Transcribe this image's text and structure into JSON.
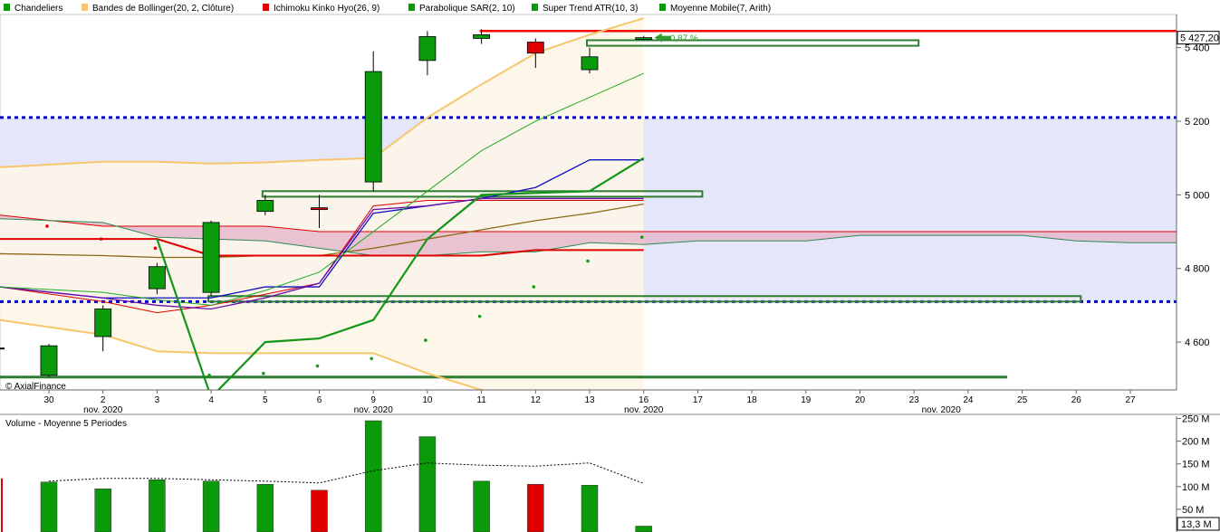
{
  "colors": {
    "up": "#0a9a0a",
    "down": "#e00000",
    "bollinger": "#f7c56b",
    "bollinger_fill": "#fdf6e6",
    "ichimoku": "#e00000",
    "ichimoku_cloud": "#e3b3c8",
    "sar": "#1a9a1a",
    "supertrend": "#13951a",
    "ma": "#8b6914",
    "resistance_band": "#e6e6fb",
    "dotted_level": "#0000cc",
    "blue_line": "#1010c0",
    "purple_line": "#6a0dad",
    "red_level": "#ff0000",
    "green_level": "#2e7d32",
    "volume_ma": "#000000"
  },
  "legend": [
    {
      "label": "Chandeliers",
      "icon": "candle-icon",
      "color": "#0a9a0a"
    },
    {
      "label": "Bandes de Bollinger(20, 2, Clôture)",
      "icon": "bollinger-icon",
      "color": "#f7c56b"
    },
    {
      "label": "Ichimoku Kinko Hyo(26, 9)",
      "icon": "ichimoku-icon",
      "color": "#e00000"
    },
    {
      "label": "Parabolique SAR(2, 10)",
      "icon": "sar-icon",
      "color": "#0a9a0a"
    },
    {
      "label": "Super Trend ATR(10, 3)",
      "icon": "supertrend-icon",
      "color": "#0a9a0a"
    },
    {
      "label": "Moyenne Mobile(7, Arith)",
      "icon": "ma-icon",
      "color": "#0a9a0a"
    }
  ],
  "watermark": "© AxialFinance",
  "last_price_label": "5 427,20",
  "pct_label": "0,87 %",
  "month_labels": [
    "nov. 2020",
    "nov. 2020",
    "nov. 2020",
    "nov. 2020"
  ],
  "volume_title": "Volume  - Moyenne 5 Periodes",
  "volume_last_label": "13,3 M",
  "chart_data": [
    {
      "type": "candlestick",
      "title": "",
      "x": [
        "30",
        "2",
        "3",
        "4",
        "5",
        "6",
        "9",
        "10",
        "11",
        "12",
        "13",
        "16",
        "17",
        "18",
        "19",
        "20",
        "23",
        "24",
        "25",
        "26",
        "27"
      ],
      "ylim": [
        4470,
        5490
      ],
      "yticks": [
        4600,
        4800,
        5000,
        5200,
        5400
      ],
      "ytick_labels": [
        "4 600",
        "4 800",
        "5 000",
        "5 200",
        "5 400"
      ],
      "candles": [
        {
          "x": "30",
          "open": 4510,
          "close": 4590,
          "high": 4595,
          "low": 4505
        },
        {
          "x": "2",
          "open": 4615,
          "close": 4690,
          "high": 4700,
          "low": 4575
        },
        {
          "x": "3",
          "open": 4745,
          "close": 4805,
          "high": 4815,
          "low": 4730
        },
        {
          "x": "4",
          "open": 4735,
          "close": 4925,
          "high": 4930,
          "low": 4725
        },
        {
          "x": "5",
          "open": 4955,
          "close": 4985,
          "high": 5000,
          "low": 4945
        },
        {
          "x": "6",
          "open": 4965,
          "close": 4960,
          "high": 5000,
          "low": 4910
        },
        {
          "x": "9",
          "open": 5035,
          "close": 5335,
          "high": 5390,
          "low": 5010
        },
        {
          "x": "10",
          "open": 5365,
          "close": 5430,
          "high": 5445,
          "low": 5325
        },
        {
          "x": "11",
          "open": 5425,
          "close": 5435,
          "high": 5450,
          "low": 5410
        },
        {
          "x": "12",
          "open": 5415,
          "close": 5385,
          "high": 5425,
          "low": 5345
        },
        {
          "x": "13",
          "open": 5340,
          "close": 5375,
          "high": 5400,
          "low": 5330
        },
        {
          "x": "16",
          "open": 5425,
          "close": 5427,
          "high": 5432,
          "low": 5420
        }
      ],
      "bollinger_upper": [
        5075,
        5090,
        5090,
        5085,
        5088,
        5095,
        5100,
        5210,
        5300,
        5385,
        5435,
        5480
      ],
      "bollinger_lower": [
        4660,
        4620,
        4575,
        4570,
        4570,
        4570,
        4570,
        4515,
        4470,
        4430,
        4395,
        4360
      ],
      "ma7": [
        4840,
        4835,
        4830,
        4830,
        4835,
        4835,
        4855,
        4880,
        4905,
        4930,
        4950,
        4975
      ],
      "ichimoku_tenkan": [
        4880,
        4880,
        4880,
        4835,
        4835,
        4835,
        4835,
        4835,
        4835,
        4850,
        4850,
        4850
      ],
      "ichimoku_kijun": [
        4750,
        4720,
        4700,
        4690,
        4720,
        4760,
        4960,
        4970,
        4990,
        4990,
        4990,
        4990
      ],
      "red_line": [
        4750,
        4710,
        4680,
        4700,
        4730,
        4760,
        4970,
        4985,
        4985,
        4985,
        4985,
        4985
      ],
      "cloud_top": [
        4945,
        4915,
        4915,
        4915,
        4915,
        4900,
        4900,
        4900,
        4900,
        4900,
        4900,
        4900,
        4900,
        4900,
        4900,
        4900,
        4900,
        4900,
        4900,
        4900,
        4900
      ],
      "cloud_bottom": [
        4935,
        4925,
        4885,
        4880,
        4875,
        4855,
        4835,
        4835,
        4845,
        4845,
        4870,
        4865,
        4875,
        4875,
        4875,
        4890,
        4890,
        4890,
        4890,
        4875,
        4870
      ],
      "blue_line": [
        4750,
        4720,
        4720,
        4720,
        4750,
        4750,
        4950,
        4970,
        4990,
        5020,
        5095,
        5095
      ],
      "sar": [
        4915,
        4880,
        4855,
        4510,
        4515,
        4535,
        4555,
        4605,
        4670,
        4750,
        4820,
        4885
      ],
      "supertrend": [
        null,
        null,
        4880,
        4450,
        4600,
        4610,
        4660,
        4880,
        5000,
        5005,
        5010,
        5100
      ],
      "supertrend_up": [
        null,
        null,
        null,
        null,
        4600,
        4610,
        4660,
        4880,
        5000,
        5005,
        5010,
        5100
      ],
      "level_dotted_top": 5210,
      "level_dotted_bottom": 4710,
      "red_level_line": 5445,
      "green_level_line": 4505,
      "zones": [
        {
          "x_start": "4",
          "x_end": "26",
          "y_low": 4710,
          "y_high": 4725
        },
        {
          "x_start": "5",
          "x_end": "17",
          "y_low": 4995,
          "y_high": 5010
        },
        {
          "x_start": "13",
          "x_end": "23",
          "y_low": 5405,
          "y_high": 5420
        }
      ]
    },
    {
      "type": "bar",
      "title": "",
      "x": [
        "30",
        "2",
        "3",
        "4",
        "5",
        "6",
        "9",
        "10",
        "11",
        "12",
        "13",
        "16"
      ],
      "values": [
        110,
        95,
        115,
        112,
        105,
        92,
        245,
        210,
        112,
        105,
        103,
        13
      ],
      "directions": [
        "up",
        "up",
        "up",
        "up",
        "up",
        "down",
        "up",
        "up",
        "up",
        "down",
        "up",
        "up"
      ],
      "ma5": [
        null,
        null,
        null,
        null,
        112,
        108,
        135,
        152,
        147,
        145,
        152,
        107
      ],
      "ylim": [
        0,
        255
      ],
      "yticks": [
        50,
        100,
        150,
        200,
        250
      ],
      "ytick_labels": [
        "50 M",
        "100 M",
        "150 M",
        "200 M",
        "250 M"
      ]
    }
  ]
}
